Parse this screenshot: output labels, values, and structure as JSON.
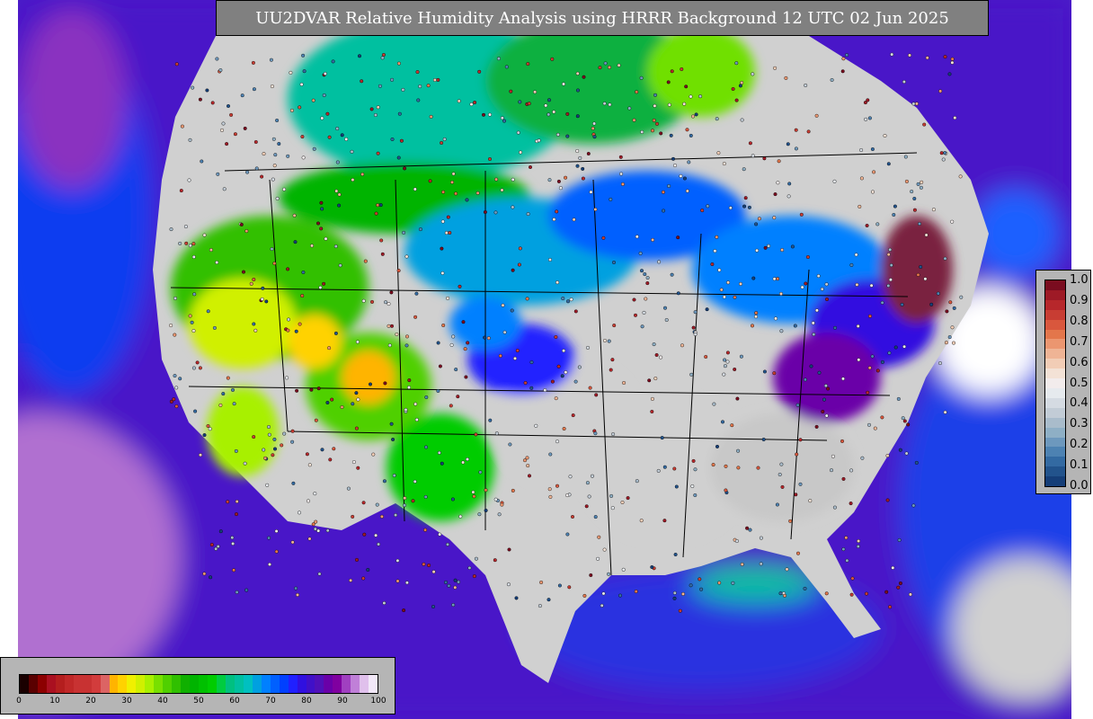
{
  "title": "UU2DVAR Relative Humidity Analysis using HRRR Background 12 UTC 02 Jun 2025",
  "colors": {
    "ocean_base": "#4a18c8",
    "land_base": "#d0d0d0",
    "title_bg": "#808080",
    "colorbar_bg": "#b5b5b5"
  },
  "observation_colorbar": {
    "ticks": [
      "1.0",
      "0.9",
      "0.8",
      "0.7",
      "0.6",
      "0.5",
      "0.4",
      "0.3",
      "0.2",
      "0.1",
      "0.0"
    ],
    "colors": [
      "#7a0c1f",
      "#9e1a26",
      "#b7272b",
      "#c83d33",
      "#d9573d",
      "#e3764b",
      "#eb9670",
      "#efb495",
      "#f2cdb6",
      "#f3e2d6",
      "#f2ecec",
      "#e6eaee",
      "#d5dbe2",
      "#c2ccd6",
      "#a9bccb",
      "#8eafc5",
      "#6d98bd",
      "#4d82b2",
      "#336aa2",
      "#22538c",
      "#153e78"
    ]
  },
  "humidity_colorbar": {
    "ticks": [
      "0",
      "10",
      "20",
      "30",
      "40",
      "50",
      "60",
      "70",
      "80",
      "90",
      "100"
    ],
    "colors": [
      "#1a0000",
      "#5a0000",
      "#8c0000",
      "#aa1020",
      "#b41e1e",
      "#c02828",
      "#c83232",
      "#c83232",
      "#d23c3c",
      "#dc6464",
      "#ffb400",
      "#ffd200",
      "#f0f000",
      "#d0f000",
      "#a8f000",
      "#78e000",
      "#50d000",
      "#30c000",
      "#10b000",
      "#00b400",
      "#00c000",
      "#00cc00",
      "#00cc40",
      "#00c080",
      "#00c0a0",
      "#00c0c0",
      "#00a0e0",
      "#0080ff",
      "#0060ff",
      "#0040ff",
      "#2020ff",
      "#3010e0",
      "#4010c8",
      "#5010b8",
      "#6a00a8",
      "#8000a0",
      "#a040c0",
      "#c080d8",
      "#e0c0ec",
      "#f2e8f8"
    ]
  }
}
